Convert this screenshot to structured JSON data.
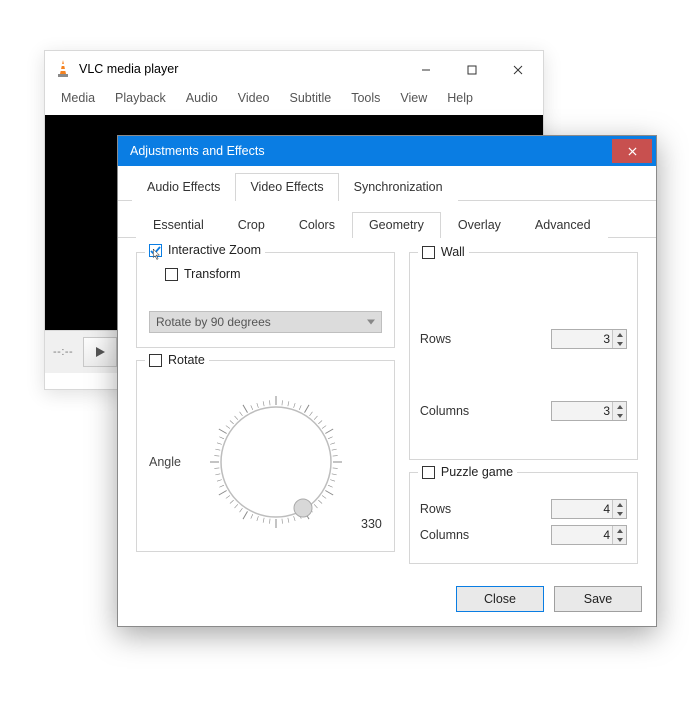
{
  "vlc": {
    "title": "VLC media player",
    "menus": [
      "Media",
      "Playback",
      "Audio",
      "Video",
      "Subtitle",
      "Tools",
      "View",
      "Help"
    ],
    "time": "--:--"
  },
  "dialog": {
    "title": "Adjustments and Effects",
    "tabs": [
      "Audio Effects",
      "Video Effects",
      "Synchronization"
    ],
    "active_tab": "Video Effects",
    "subtabs": [
      "Essential",
      "Crop",
      "Colors",
      "Geometry",
      "Overlay",
      "Advanced"
    ],
    "active_subtab": "Geometry",
    "left": {
      "interactive_zoom": {
        "label": "Interactive Zoom",
        "checked": true
      },
      "transform": {
        "label": "Transform",
        "checked": false,
        "combo": "Rotate by 90 degrees"
      },
      "rotate": {
        "label": "Rotate",
        "checked": false,
        "angle_label": "Angle",
        "reading": "330"
      }
    },
    "right": {
      "wall": {
        "label": "Wall",
        "checked": false,
        "rows": {
          "label": "Rows",
          "value": "3"
        },
        "cols": {
          "label": "Columns",
          "value": "3"
        }
      },
      "puzzle": {
        "label": "Puzzle game",
        "checked": false,
        "rows": {
          "label": "Rows",
          "value": "4"
        },
        "cols": {
          "label": "Columns",
          "value": "4"
        }
      }
    },
    "buttons": {
      "close": "Close",
      "save": "Save"
    }
  }
}
